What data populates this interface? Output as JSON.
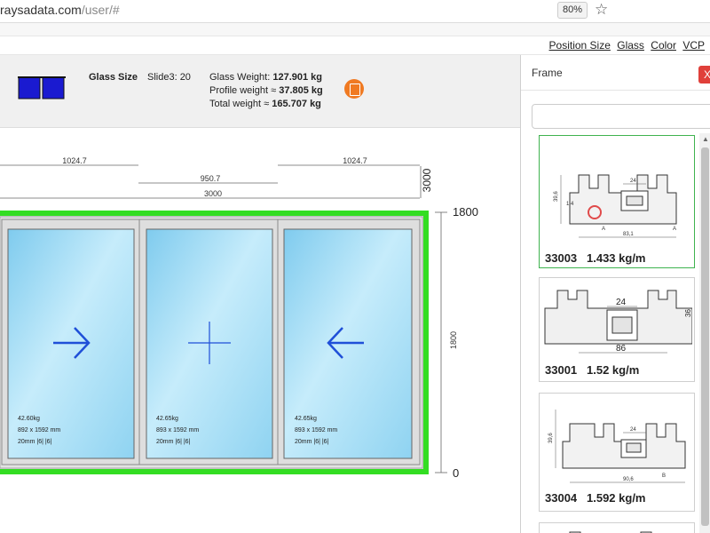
{
  "browser": {
    "url_host": "raysadata.com",
    "url_path": "/user/#",
    "zoom": "80%",
    "star_icon": "star-icon"
  },
  "nav": {
    "items": [
      "Position Size",
      "Glass",
      "Color",
      "VCP"
    ]
  },
  "info": {
    "glass_size_label": "Glass Size",
    "slide_label": "Slide3: 20",
    "glass_weight_label": "Glass Weight:",
    "glass_weight_value": "127.901 kg",
    "profile_weight_label": "Profile weight ≈",
    "profile_weight_value": "37.805 kg",
    "total_weight_label": "Total weight ≈",
    "total_weight_value": "165.707 kg",
    "export_icon": "export-icon"
  },
  "drawing": {
    "dims": {
      "left": "1024.7",
      "middle": "950.7",
      "right": "1024.7",
      "total": "3000",
      "total_vertical": "3000",
      "height_top": "1800",
      "height_mid": "1800",
      "height_bottom": "0"
    },
    "panes": [
      {
        "weight": "42.60kg",
        "size": "892 x 1592 mm",
        "spec": "20mm |6| |6|",
        "icon": "arrow-right-icon"
      },
      {
        "weight": "42.65kg",
        "size": "893 x 1592 mm",
        "spec": "20mm |6| |6|",
        "icon": "plus-icon"
      },
      {
        "weight": "42.65kg",
        "size": "893 x 1592 mm",
        "spec": "20mm |6| |6|",
        "icon": "arrow-left-icon"
      }
    ],
    "colors": {
      "frame_highlight": "#33dd22",
      "glass_light": "#d4f1fd",
      "glass_dark": "#7fcbee",
      "arrow": "#1f4fd8"
    }
  },
  "side_panel": {
    "title": "Frame",
    "close_label": "X",
    "search_placeholder": "",
    "cards": [
      {
        "code": "33003",
        "weight": "1.433 kg/m",
        "selected": true
      },
      {
        "code": "33001",
        "weight": "1.52 kg/m",
        "selected": false
      },
      {
        "code": "33004",
        "weight": "1.592 kg/m",
        "selected": false
      }
    ],
    "profile_dims": {
      "a_dim_39": "39,6",
      "a_dim_14": "1,4",
      "a_dim_24": "24",
      "a_dim_83": "83,1",
      "a_mark": "A",
      "b_dim_24": "24",
      "b_dim_86": "86",
      "b_dim_36": "36",
      "c_dim_39": "39,6",
      "c_dim_24": "24",
      "c_dim_90": "90,6",
      "c_mark": "B"
    }
  }
}
